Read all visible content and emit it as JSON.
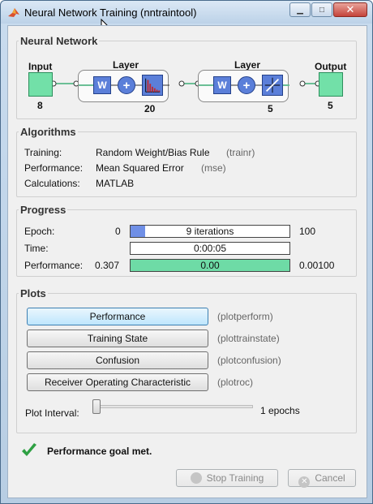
{
  "window": {
    "title": "Neural Network Training (nntraintool)"
  },
  "network": {
    "legend": "Neural Network",
    "input": {
      "label": "Input",
      "size": "8"
    },
    "hidden_layer": {
      "label": "Layer",
      "size": "20",
      "weight": "W",
      "bias": "+"
    },
    "output_layer": {
      "label": "Layer",
      "size": "5",
      "weight": "W",
      "bias": "+"
    },
    "output": {
      "label": "Output",
      "size": "5"
    }
  },
  "algorithms": {
    "legend": "Algorithms",
    "rows": [
      {
        "label": "Training:",
        "value": "Random Weight/Bias Rule",
        "fn": "(trainr)"
      },
      {
        "label": "Performance:",
        "value": "Mean Squared Error",
        "fn": "(mse)"
      },
      {
        "label": "Calculations:",
        "value": "MATLAB",
        "fn": ""
      }
    ]
  },
  "progress": {
    "legend": "Progress",
    "epoch": {
      "label": "Epoch:",
      "min": "0",
      "text": "9 iterations",
      "max": "100",
      "fill_fraction": 0.09,
      "color": "#6f8fe6"
    },
    "time": {
      "label": "Time:",
      "text": "0:00:05"
    },
    "performance": {
      "label": "Performance:",
      "min": "0.307",
      "text": "0.00",
      "max": "0.00100",
      "fill_fraction": 1.0,
      "color": "#6edba6"
    }
  },
  "plots": {
    "legend": "Plots",
    "buttons": [
      {
        "label": "Performance",
        "fn": "(plotperform)"
      },
      {
        "label": "Training State",
        "fn": "(plottrainstate)"
      },
      {
        "label": "Confusion",
        "fn": "(plotconfusion)"
      },
      {
        "label": "Receiver Operating Characteristic",
        "fn": "(plotroc)"
      }
    ],
    "interval": {
      "label": "Plot Interval:",
      "value_text": "1 epochs",
      "fraction": 0.0
    }
  },
  "status": {
    "icon": "checkmark-icon",
    "text": "Performance goal met.",
    "color": "#2ea043"
  },
  "footer": {
    "stop_label": "Stop Training",
    "cancel_label": "Cancel"
  }
}
